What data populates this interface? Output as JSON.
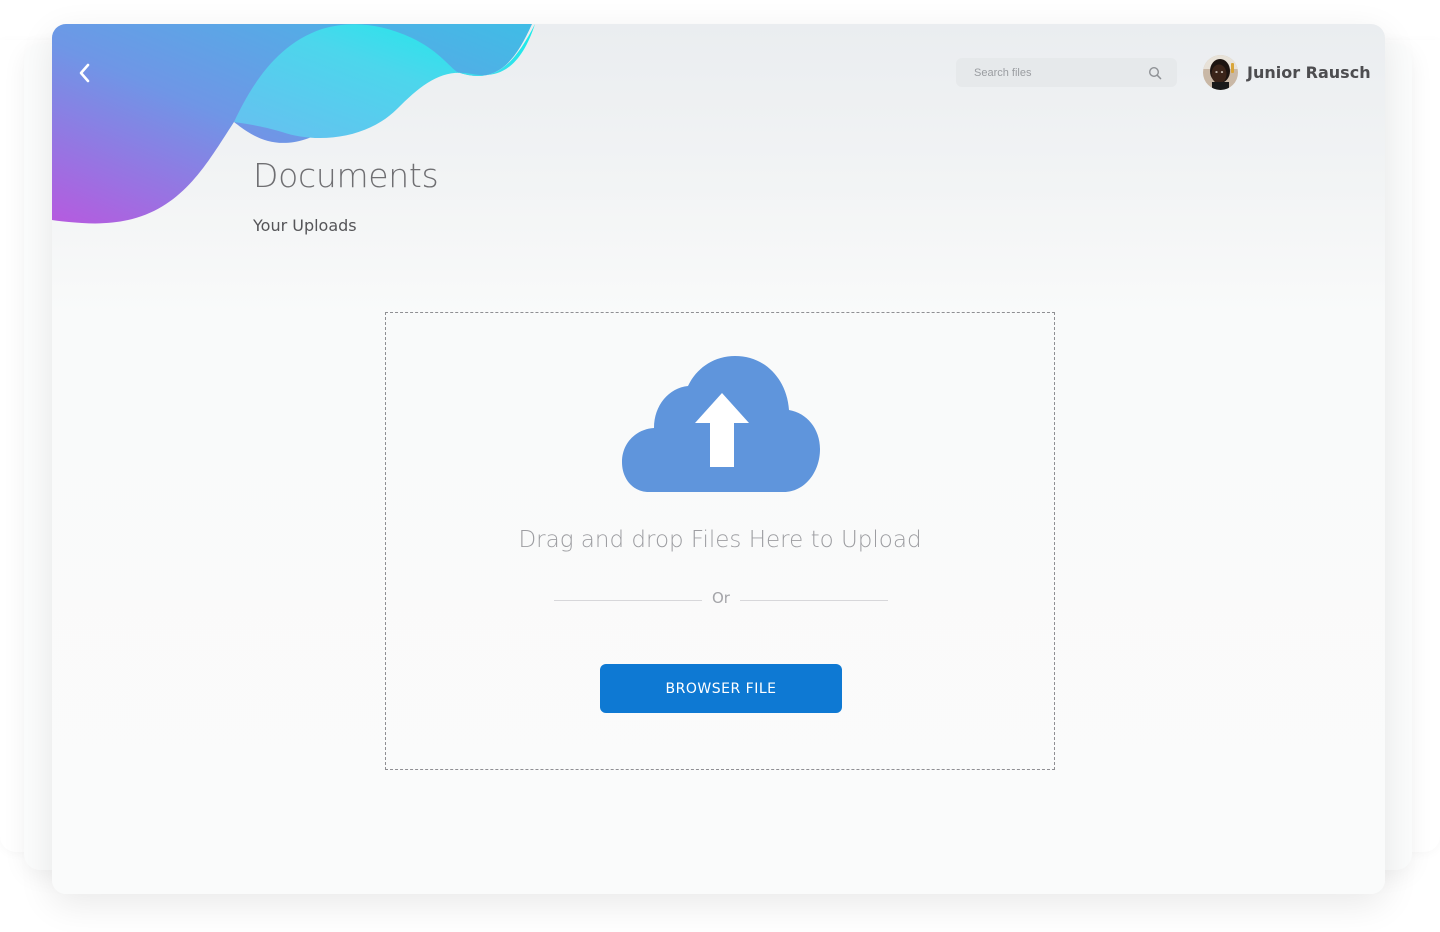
{
  "header": {
    "back_icon": "chevron-left-icon",
    "search": {
      "placeholder": "Search files",
      "value": "",
      "icon": "search-icon"
    },
    "user": {
      "name": "Junior Rausch",
      "avatar": "avatar-photo"
    }
  },
  "page": {
    "title": "Documents",
    "subtitle": "Your Uploads"
  },
  "upload": {
    "icon": "cloud-upload-icon",
    "instruction": "Drag and drop Files Here to Upload",
    "divider_text": "Or",
    "button_label": "BROWSER FILE"
  },
  "colors": {
    "accent": "#0e79d3",
    "cloud": "#5f95dc",
    "gradient_purple": "#b45ddf",
    "gradient_blue": "#5aaee9",
    "gradient_cyan": "#18eaeb"
  }
}
